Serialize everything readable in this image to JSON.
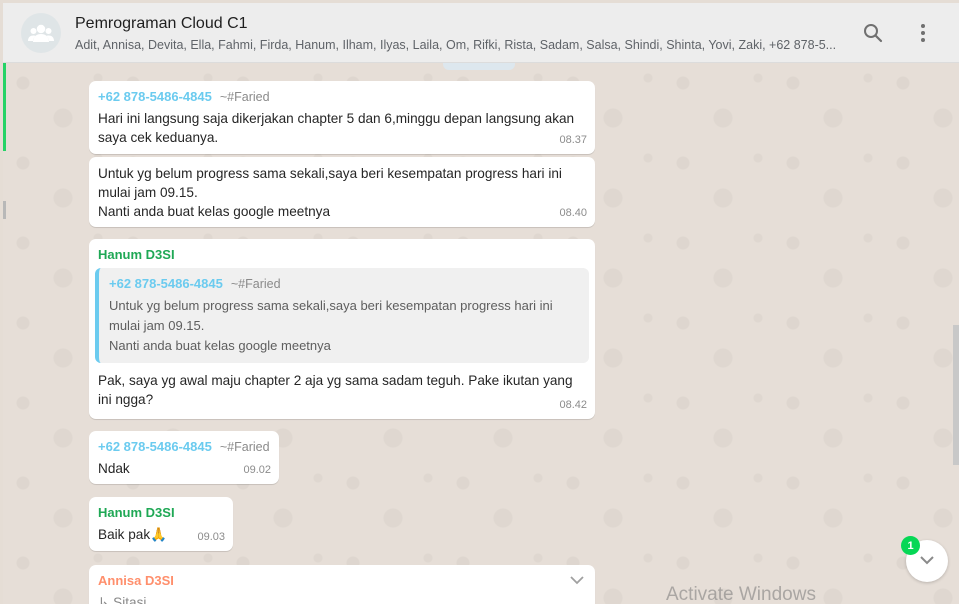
{
  "header": {
    "title": "Pemrograman Cloud C1",
    "members": "Adit, Annisa, Devita, Ella, Fahmi, Firda, Hanum, Ilham, Ilyas, Laila, Om, Rifki, Rista, Sadam, Salsa, Shindi, Shinta, Yovi, Zaki, +62 878-5...",
    "icons": [
      "group-avatar-icon",
      "search-icon",
      "menu-icon"
    ]
  },
  "messages": [
    {
      "sender": "+62 878-5486-4845",
      "alias": "~#Faried",
      "text": "Hari ini langsung saja dikerjakan chapter 5 dan 6,minggu depan langsung akan saya cek keduanya.",
      "time": "08.37"
    },
    {
      "text_line1": "Untuk yg belum progress sama sekali,saya beri kesempatan progress hari ini mulai jam 09.15.",
      "text_line2": "Nanti anda buat kelas google meetnya",
      "time": "08.40"
    },
    {
      "sender": "Hanum D3SI",
      "quote": {
        "sender": "+62 878-5486-4845",
        "alias": "~#Faried",
        "text_line1": "Untuk yg belum progress sama sekali,saya beri kesempatan progress hari ini mulai jam 09.15.",
        "text_line2": "Nanti anda buat kelas google meetnya"
      },
      "text": "Pak, saya yg awal maju chapter 2 aja yg sama sadam teguh. Pake ikutan yang ini ngga?",
      "time": "08.42"
    },
    {
      "sender": "+62 878-5486-4845",
      "alias": "~#Faried",
      "text": "Ndak",
      "time": "09.02"
    },
    {
      "sender": "Hanum D3SI",
      "text": "Baik pak🙏",
      "time": "09.03"
    },
    {
      "sender": "Annisa D3SI",
      "text": "Sitasi"
    }
  ],
  "scroll_button": {
    "unread_count": "1"
  },
  "watermark": "Activate Windows",
  "colors": {
    "header_bg": "#ededed",
    "chat_bg": "#e6ded7",
    "bubble_bg": "#ffffff",
    "sender_number": "#6bcbef",
    "sender_hanum": "#1fa855",
    "sender_annisa": "#ff8f6c",
    "unread_badge": "#06d755"
  }
}
